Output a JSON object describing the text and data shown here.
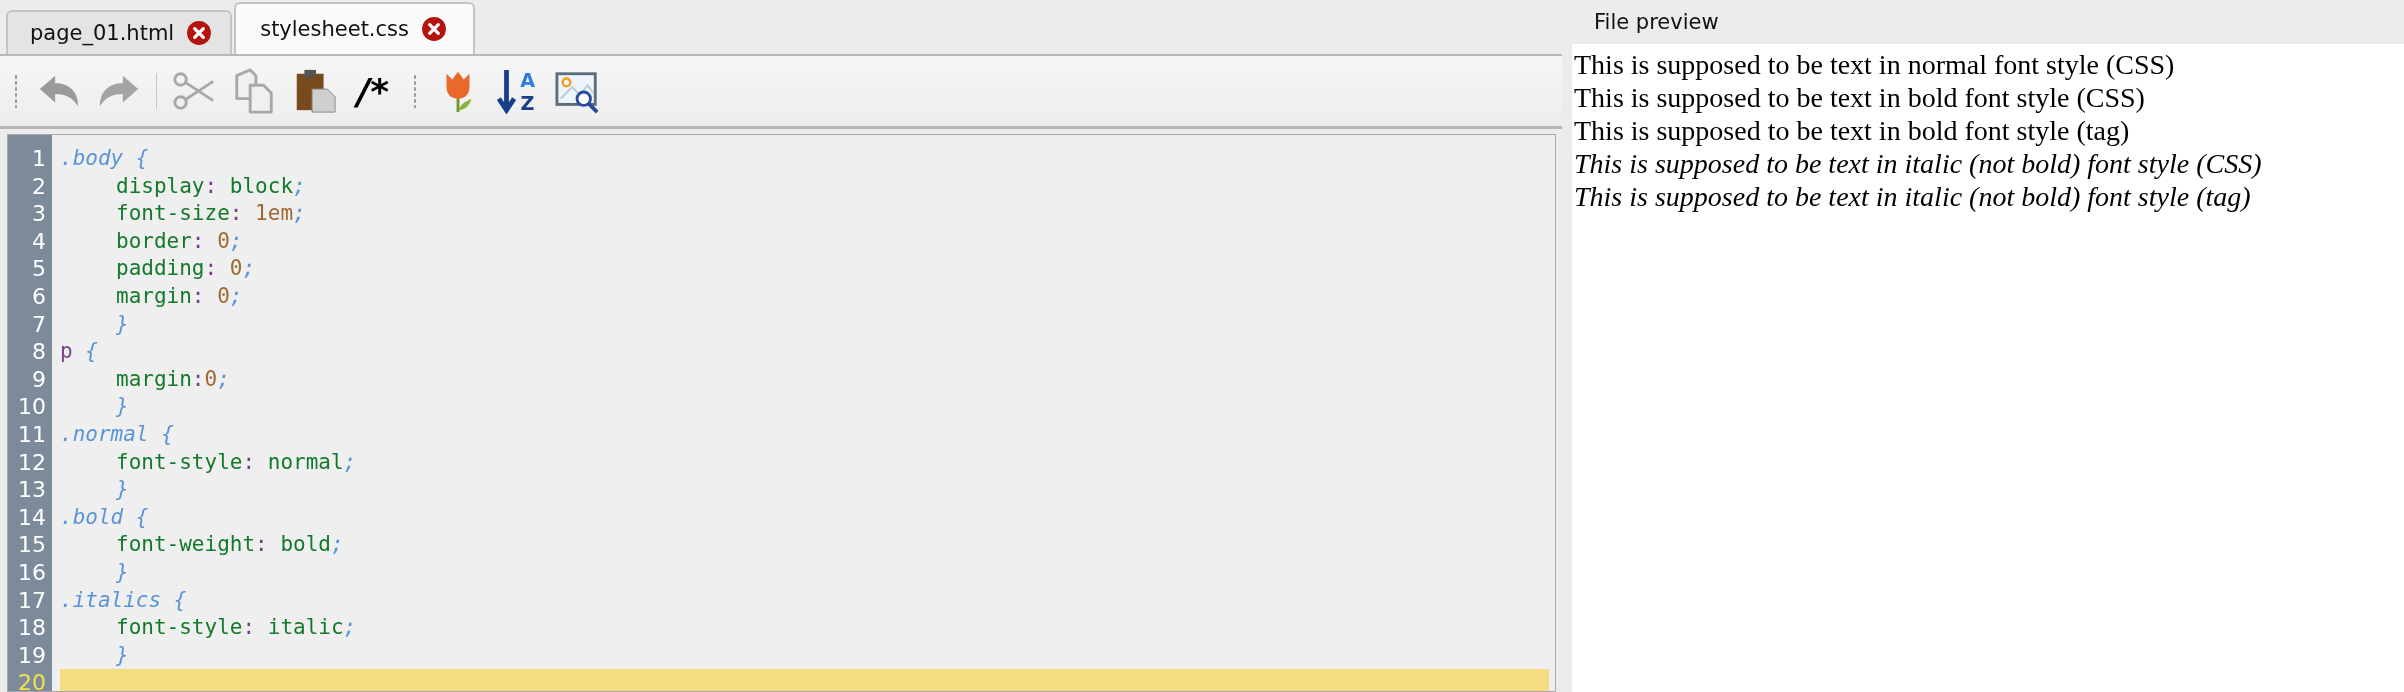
{
  "tabs": [
    {
      "label": "page_01.html",
      "selected": false
    },
    {
      "label": "stylesheet.css",
      "selected": true
    }
  ],
  "toolbar": [
    {
      "kind": "undo",
      "disabled": true
    },
    {
      "kind": "redo",
      "disabled": true
    },
    {
      "kind": "separator"
    },
    {
      "kind": "cut",
      "disabled": true
    },
    {
      "kind": "copy",
      "disabled": true
    },
    {
      "kind": "paste",
      "disabled": false
    },
    {
      "kind": "comment",
      "label": "/*",
      "disabled": false
    },
    {
      "kind": "grip"
    },
    {
      "kind": "tulip",
      "disabled": false
    },
    {
      "kind": "sort",
      "letters": [
        "A",
        "Z"
      ],
      "disabled": false
    },
    {
      "kind": "image-search",
      "disabled": false
    }
  ],
  "editor": {
    "lines": [
      {
        "number": "1",
        "indented": false,
        "current": false,
        "tokens": [
          {
            "kind": "selector",
            "text": ".body {"
          }
        ]
      },
      {
        "number": "2",
        "indented": true,
        "current": false,
        "tokens": [
          {
            "kind": "property",
            "text": "display"
          },
          {
            "kind": "colon",
            "text": ": "
          },
          {
            "kind": "keyword",
            "text": "block"
          },
          {
            "kind": "semicolon",
            "text": ";"
          }
        ]
      },
      {
        "number": "3",
        "indented": true,
        "current": false,
        "tokens": [
          {
            "kind": "property",
            "text": "font-size"
          },
          {
            "kind": "colon",
            "text": ": "
          },
          {
            "kind": "number",
            "text": "1em"
          },
          {
            "kind": "semicolon",
            "text": ";"
          }
        ]
      },
      {
        "number": "4",
        "indented": true,
        "current": false,
        "tokens": [
          {
            "kind": "property",
            "text": "border"
          },
          {
            "kind": "colon",
            "text": ": "
          },
          {
            "kind": "number",
            "text": "0"
          },
          {
            "kind": "semicolon",
            "text": ";"
          }
        ]
      },
      {
        "number": "5",
        "indented": true,
        "current": false,
        "tokens": [
          {
            "kind": "property",
            "text": "padding"
          },
          {
            "kind": "colon",
            "text": ": "
          },
          {
            "kind": "number",
            "text": "0"
          },
          {
            "kind": "semicolon",
            "text": ";"
          }
        ]
      },
      {
        "number": "6",
        "indented": true,
        "current": false,
        "tokens": [
          {
            "kind": "property",
            "text": "margin"
          },
          {
            "kind": "colon",
            "text": ": "
          },
          {
            "kind": "number",
            "text": "0"
          },
          {
            "kind": "semicolon",
            "text": ";"
          }
        ]
      },
      {
        "number": "7",
        "indented": true,
        "current": false,
        "tokens": [
          {
            "kind": "brace",
            "text": "}"
          }
        ]
      },
      {
        "number": "8",
        "indented": false,
        "current": false,
        "tokens": [
          {
            "kind": "tag",
            "text": "p "
          },
          {
            "kind": "brace",
            "text": "{"
          }
        ]
      },
      {
        "number": "9",
        "indented": true,
        "current": false,
        "tokens": [
          {
            "kind": "property",
            "text": "margin"
          },
          {
            "kind": "colon",
            "text": ":"
          },
          {
            "kind": "number",
            "text": "0"
          },
          {
            "kind": "semicolon",
            "text": ";"
          }
        ]
      },
      {
        "number": "10",
        "indented": true,
        "current": false,
        "tokens": [
          {
            "kind": "brace",
            "text": "}"
          }
        ]
      },
      {
        "number": "11",
        "indented": false,
        "current": false,
        "tokens": [
          {
            "kind": "selector",
            "text": ".normal {"
          }
        ]
      },
      {
        "number": "12",
        "indented": true,
        "current": false,
        "tokens": [
          {
            "kind": "property",
            "text": "font-style"
          },
          {
            "kind": "colon",
            "text": ": "
          },
          {
            "kind": "keyword",
            "text": "normal"
          },
          {
            "kind": "semicolon",
            "text": ";"
          }
        ]
      },
      {
        "number": "13",
        "indented": true,
        "current": false,
        "tokens": [
          {
            "kind": "brace",
            "text": "}"
          }
        ]
      },
      {
        "number": "14",
        "indented": false,
        "current": false,
        "tokens": [
          {
            "kind": "selector",
            "text": ".bold {"
          }
        ]
      },
      {
        "number": "15",
        "indented": true,
        "current": false,
        "tokens": [
          {
            "kind": "property",
            "text": "font-weight"
          },
          {
            "kind": "colon",
            "text": ": "
          },
          {
            "kind": "keyword",
            "text": "bold"
          },
          {
            "kind": "semicolon",
            "text": ";"
          }
        ]
      },
      {
        "number": "16",
        "indented": true,
        "current": false,
        "tokens": [
          {
            "kind": "brace",
            "text": "}"
          }
        ]
      },
      {
        "number": "17",
        "indented": false,
        "current": false,
        "tokens": [
          {
            "kind": "selector",
            "text": ".italics {"
          }
        ]
      },
      {
        "number": "18",
        "indented": true,
        "current": false,
        "tokens": [
          {
            "kind": "property",
            "text": "font-style"
          },
          {
            "kind": "colon",
            "text": ": "
          },
          {
            "kind": "keyword",
            "text": "italic"
          },
          {
            "kind": "semicolon",
            "text": ";"
          }
        ]
      },
      {
        "number": "19",
        "indented": true,
        "current": false,
        "tokens": [
          {
            "kind": "brace",
            "text": "}"
          }
        ]
      },
      {
        "number": "20",
        "current": true
      }
    ]
  },
  "preview": {
    "title": "File preview",
    "lines": [
      {
        "text": "This is supposed to be text in normal font style (CSS)",
        "italic": false
      },
      {
        "text": "This is supposed to be text in bold font style (CSS)",
        "italic": false
      },
      {
        "text": "This is supposed to be text in bold font style (tag)",
        "italic": false
      },
      {
        "text": "This is supposed to be text in italic (not bold) font style (CSS)",
        "italic": true
      },
      {
        "text": "This is supposed to be text in italic (not bold) font style (tag)",
        "italic": true
      }
    ]
  }
}
